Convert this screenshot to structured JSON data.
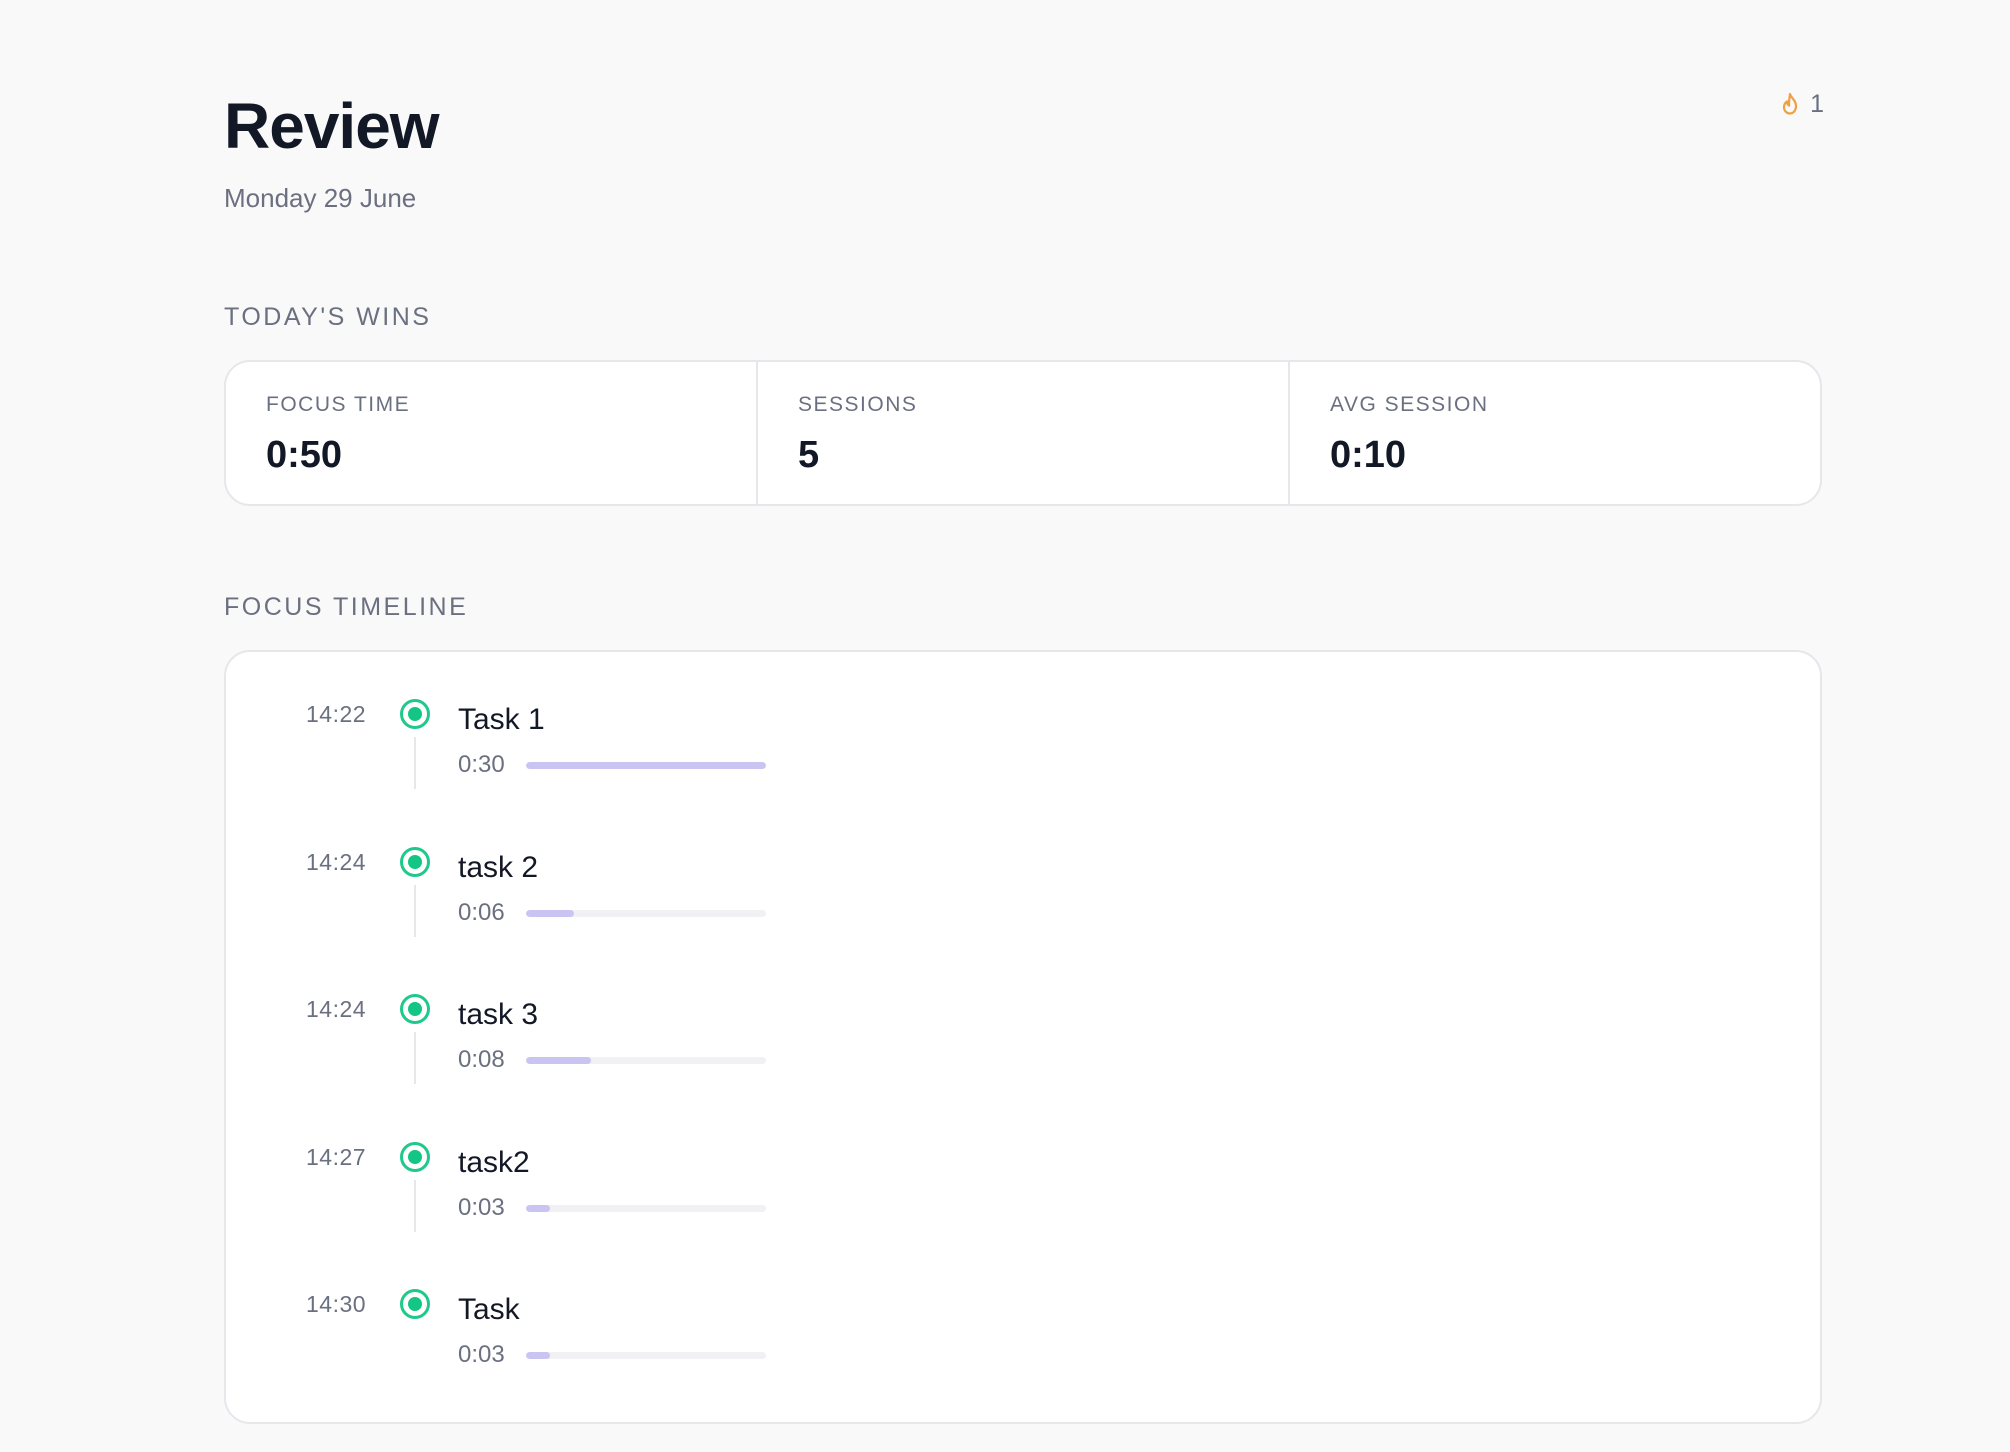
{
  "header": {
    "title": "Review",
    "date": "Monday 29 June",
    "streak": {
      "icon": "flame-icon",
      "count": "1",
      "color": "#f0a040"
    }
  },
  "wins": {
    "label": "TODAY'S WINS",
    "stats": [
      {
        "label": "FOCUS TIME",
        "value": "0:50"
      },
      {
        "label": "SESSIONS",
        "value": "5"
      },
      {
        "label": "AVG SESSION",
        "value": "0:10"
      }
    ]
  },
  "timeline": {
    "label": "FOCUS TIMELINE",
    "accent_color": "#13c684",
    "bar_color": "#c9c4f2",
    "entries": [
      {
        "time": "14:22",
        "name": "Task 1",
        "duration": "0:30",
        "progress": 1.0
      },
      {
        "time": "14:24",
        "name": "task 2",
        "duration": "0:06",
        "progress": 0.2
      },
      {
        "time": "14:24",
        "name": "task 3",
        "duration": "0:08",
        "progress": 0.27
      },
      {
        "time": "14:27",
        "name": "task2",
        "duration": "0:03",
        "progress": 0.1
      },
      {
        "time": "14:30",
        "name": "Task",
        "duration": "0:03",
        "progress": 0.1
      }
    ]
  }
}
